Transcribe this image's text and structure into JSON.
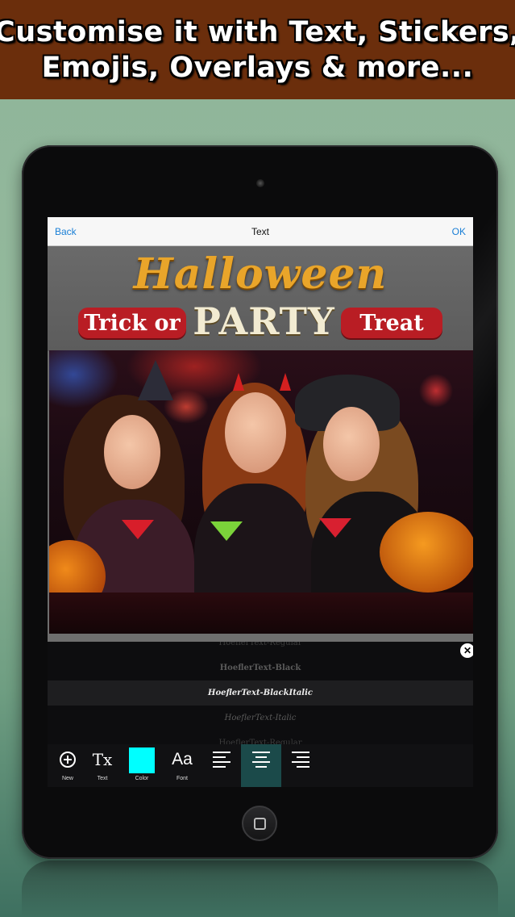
{
  "banner": {
    "line1": "Customise it with Text, Stickers,",
    "line2": "Emojis, Overlays & more..."
  },
  "navbar": {
    "back_label": "Back",
    "title": "Text",
    "ok_label": "OK"
  },
  "poster": {
    "title": "Halloween",
    "left_pill": "Trick or",
    "center_word": "PARTY",
    "right_pill": "Treat"
  },
  "font_list": {
    "items": [
      "HoeflerText-Regular",
      "HoeflerText-Black",
      "HoeflerText-BlackItalic",
      "HoeflerText-Italic",
      "HoeflerText-Regular"
    ],
    "selected_index": 2
  },
  "toolbar": {
    "new_label": "New",
    "text_label": "Text",
    "text_icon": "Tx",
    "color_label": "Color",
    "font_label": "Font",
    "font_icon": "Aa",
    "selected_color": "#00ffff",
    "active_tool": "align-center"
  },
  "colors": {
    "banner_bg": "#6b2e0c",
    "accent_blue": "#1a7fd6",
    "active_tool_bg": "#1b4a4a"
  },
  "icons": {
    "close": "close-icon",
    "new": "plus-circle-icon",
    "align_left": "align-left-icon",
    "align_center": "align-center-icon",
    "align_right": "align-right-icon"
  }
}
